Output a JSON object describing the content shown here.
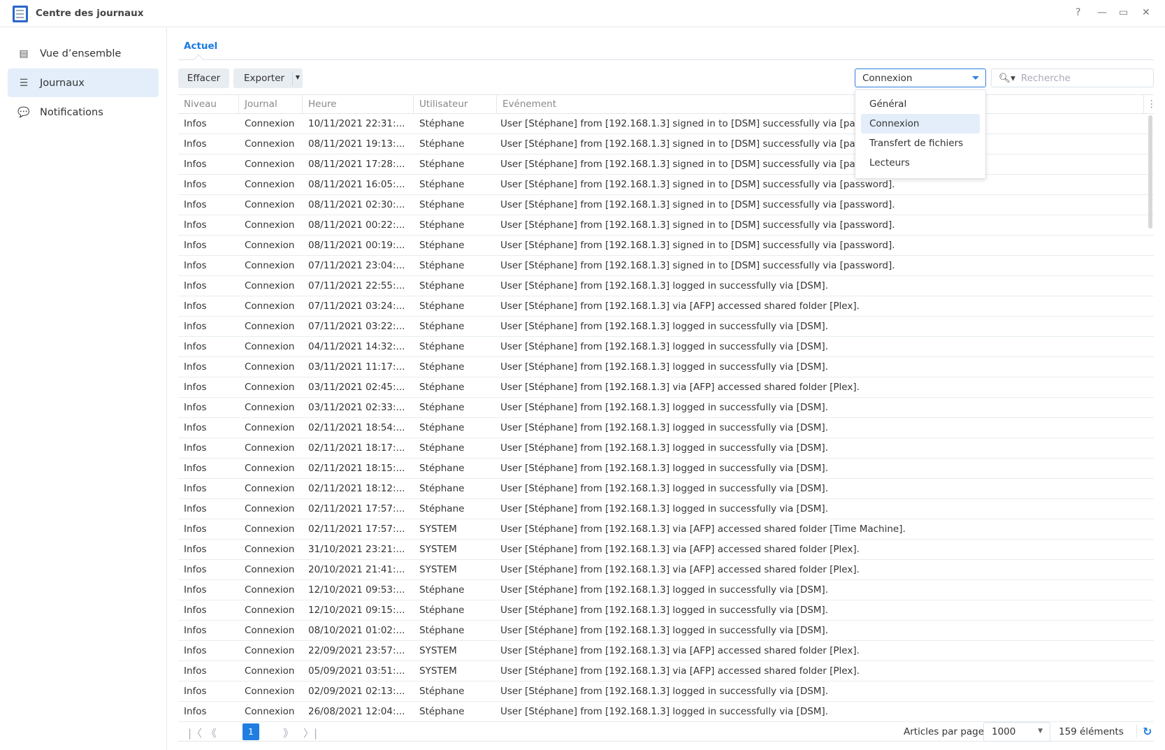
{
  "window": {
    "title": "Centre des journaux",
    "help": "?",
    "minimize": "—",
    "maximize": "▭",
    "close": "✕"
  },
  "sidebar": {
    "items": [
      {
        "label": "Vue d’ensemble",
        "icon": "overview-icon"
      },
      {
        "label": "Journaux",
        "icon": "list-icon"
      },
      {
        "label": "Notifications",
        "icon": "chat-icon"
      }
    ]
  },
  "tab": "Actuel",
  "toolbar": {
    "clear": "Effacer",
    "export": "Exporter",
    "filter_value": "Connexion",
    "search_placeholder": "Recherche"
  },
  "filter_menu": [
    "Général",
    "Connexion",
    "Transfert de fichiers",
    "Lecteurs"
  ],
  "table": {
    "headers": [
      "Niveau",
      "Journal",
      "Heure",
      "Utilisateur",
      "Evénement"
    ],
    "rows": [
      [
        "Infos",
        "Connexion",
        "10/11/2021 22:31:...",
        "Stéphane",
        "User [Stéphane] from [192.168.1.3] signed in to [DSM] successfully via [password]."
      ],
      [
        "Infos",
        "Connexion",
        "08/11/2021 19:13:...",
        "Stéphane",
        "User [Stéphane] from [192.168.1.3] signed in to [DSM] successfully via [password]."
      ],
      [
        "Infos",
        "Connexion",
        "08/11/2021 17:28:...",
        "Stéphane",
        "User [Stéphane] from [192.168.1.3] signed in to [DSM] successfully via [password]."
      ],
      [
        "Infos",
        "Connexion",
        "08/11/2021 16:05:...",
        "Stéphane",
        "User [Stéphane] from [192.168.1.3] signed in to [DSM] successfully via [password]."
      ],
      [
        "Infos",
        "Connexion",
        "08/11/2021 02:30:...",
        "Stéphane",
        "User [Stéphane] from [192.168.1.3] signed in to [DSM] successfully via [password]."
      ],
      [
        "Infos",
        "Connexion",
        "08/11/2021 00:22:...",
        "Stéphane",
        "User [Stéphane] from [192.168.1.3] signed in to [DSM] successfully via [password]."
      ],
      [
        "Infos",
        "Connexion",
        "08/11/2021 00:19:...",
        "Stéphane",
        "User [Stéphane] from [192.168.1.3] signed in to [DSM] successfully via [password]."
      ],
      [
        "Infos",
        "Connexion",
        "07/11/2021 23:04:...",
        "Stéphane",
        "User [Stéphane] from [192.168.1.3] signed in to [DSM] successfully via [password]."
      ],
      [
        "Infos",
        "Connexion",
        "07/11/2021 22:55:...",
        "Stéphane",
        "User [Stéphane] from [192.168.1.3] logged in successfully via [DSM]."
      ],
      [
        "Infos",
        "Connexion",
        "07/11/2021 03:24:...",
        "Stéphane",
        "User [Stéphane] from [192.168.1.3] via [AFP] accessed shared folder [Plex]."
      ],
      [
        "Infos",
        "Connexion",
        "07/11/2021 03:22:...",
        "Stéphane",
        "User [Stéphane] from [192.168.1.3] logged in successfully via [DSM]."
      ],
      [
        "Infos",
        "Connexion",
        "04/11/2021 14:32:...",
        "Stéphane",
        "User [Stéphane] from [192.168.1.3] logged in successfully via [DSM]."
      ],
      [
        "Infos",
        "Connexion",
        "03/11/2021 11:17:...",
        "Stéphane",
        "User [Stéphane] from [192.168.1.3] logged in successfully via [DSM]."
      ],
      [
        "Infos",
        "Connexion",
        "03/11/2021 02:45:...",
        "Stéphane",
        "User [Stéphane] from [192.168.1.3] via [AFP] accessed shared folder [Plex]."
      ],
      [
        "Infos",
        "Connexion",
        "03/11/2021 02:33:...",
        "Stéphane",
        "User [Stéphane] from [192.168.1.3] logged in successfully via [DSM]."
      ],
      [
        "Infos",
        "Connexion",
        "02/11/2021 18:54:...",
        "Stéphane",
        "User [Stéphane] from [192.168.1.3] logged in successfully via [DSM]."
      ],
      [
        "Infos",
        "Connexion",
        "02/11/2021 18:17:...",
        "Stéphane",
        "User [Stéphane] from [192.168.1.3] logged in successfully via [DSM]."
      ],
      [
        "Infos",
        "Connexion",
        "02/11/2021 18:15:...",
        "Stéphane",
        "User [Stéphane] from [192.168.1.3] logged in successfully via [DSM]."
      ],
      [
        "Infos",
        "Connexion",
        "02/11/2021 18:12:...",
        "Stéphane",
        "User [Stéphane] from [192.168.1.3] logged in successfully via [DSM]."
      ],
      [
        "Infos",
        "Connexion",
        "02/11/2021 17:57:...",
        "Stéphane",
        "User [Stéphane] from [192.168.1.3] logged in successfully via [DSM]."
      ],
      [
        "Infos",
        "Connexion",
        "02/11/2021 17:57:...",
        "SYSTEM",
        "User [Stéphane] from [192.168.1.3] via [AFP] accessed shared folder [Time Machine]."
      ],
      [
        "Infos",
        "Connexion",
        "31/10/2021 23:21:...",
        "SYSTEM",
        "User [Stéphane] from [192.168.1.3] via [AFP] accessed shared folder [Plex]."
      ],
      [
        "Infos",
        "Connexion",
        "20/10/2021 21:41:...",
        "SYSTEM",
        "User [Stéphane] from [192.168.1.3] via [AFP] accessed shared folder [Plex]."
      ],
      [
        "Infos",
        "Connexion",
        "12/10/2021 09:53:...",
        "Stéphane",
        "User [Stéphane] from [192.168.1.3] logged in successfully via [DSM]."
      ],
      [
        "Infos",
        "Connexion",
        "12/10/2021 09:15:...",
        "Stéphane",
        "User [Stéphane] from [192.168.1.3] logged in successfully via [DSM]."
      ],
      [
        "Infos",
        "Connexion",
        "08/10/2021 01:02:...",
        "Stéphane",
        "User [Stéphane] from [192.168.1.3] logged in successfully via [DSM]."
      ],
      [
        "Infos",
        "Connexion",
        "22/09/2021 23:57:...",
        "SYSTEM",
        "User [Stéphane] from [192.168.1.3] via [AFP] accessed shared folder [Plex]."
      ],
      [
        "Infos",
        "Connexion",
        "05/09/2021 03:51:...",
        "SYSTEM",
        "User [Stéphane] from [192.168.1.3] via [AFP] accessed shared folder [Plex]."
      ],
      [
        "Infos",
        "Connexion",
        "02/09/2021 02:13:...",
        "Stéphane",
        "User [Stéphane] from [192.168.1.3] logged in successfully via [DSM]."
      ],
      [
        "Infos",
        "Connexion",
        "26/08/2021 12:04:...",
        "Stéphane",
        "User [Stéphane] from [192.168.1.3] logged in successfully via [DSM]."
      ]
    ]
  },
  "pager": {
    "current_page": "1",
    "per_page_label": "Articles par page",
    "per_page": "1000",
    "total": "159 éléments"
  }
}
